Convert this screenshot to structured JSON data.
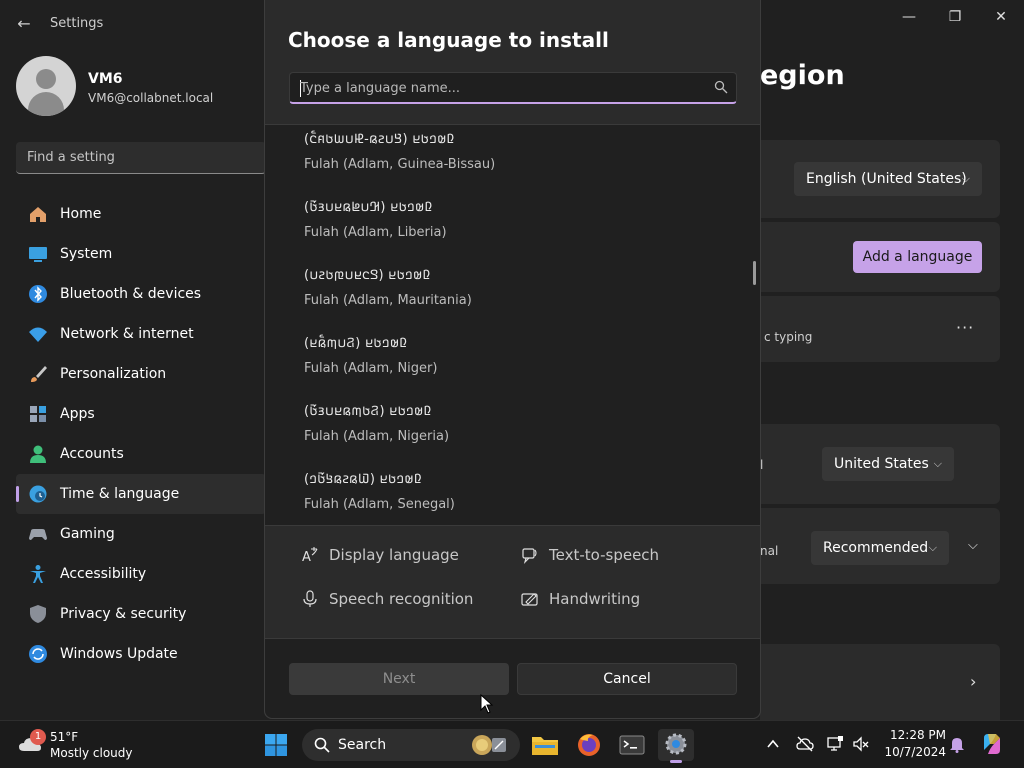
{
  "window": {
    "app_title": "Settings",
    "minimize_glyph": "—",
    "maximize_glyph": "❐",
    "close_glyph": "✕",
    "back_glyph": "←"
  },
  "profile": {
    "name": "VM6",
    "email": "VM6@collabnet.local"
  },
  "search": {
    "placeholder": "Find a setting"
  },
  "sidebar": {
    "items": [
      {
        "label": "Home",
        "icon": "home-icon",
        "color": "#e3a06a"
      },
      {
        "label": "System",
        "icon": "system-icon",
        "color": "#3aa0e0"
      },
      {
        "label": "Bluetooth & devices",
        "icon": "bluetooth-icon",
        "color": "#2f8ae0"
      },
      {
        "label": "Network & internet",
        "icon": "wifi-icon",
        "color": "#3a9ee8"
      },
      {
        "label": "Personalization",
        "icon": "brush-icon",
        "color": "#e89a5a"
      },
      {
        "label": "Apps",
        "icon": "apps-icon",
        "color": "#7a8ea8"
      },
      {
        "label": "Accounts",
        "icon": "person-icon",
        "color": "#3fbf7a"
      },
      {
        "label": "Time & language",
        "icon": "clock-globe-icon",
        "color": "#3aa0e0"
      },
      {
        "label": "Gaming",
        "icon": "gamepad-icon",
        "color": "#9aa0aa"
      },
      {
        "label": "Accessibility",
        "icon": "accessibility-icon",
        "color": "#3aa0e0"
      },
      {
        "label": "Privacy & security",
        "icon": "shield-icon",
        "color": "#8a8f98"
      },
      {
        "label": "Windows Update",
        "icon": "update-icon",
        "color": "#2f8ae0"
      }
    ],
    "selected_index": 7
  },
  "content": {
    "title_fragment": "egion",
    "display_language_value": "English (United States)",
    "add_language_label": "Add a language",
    "typing_fragment": "c typing",
    "more_glyph": "···",
    "country_value": "United States",
    "regional_fragment": "nal",
    "regional_format_value": "Recommended",
    "accent_color": "#c6a2e8"
  },
  "dialog": {
    "title": "Choose a language to install",
    "search_placeholder": "Type a language name...",
    "languages": [
      {
        "native": "(𞤘𞤭𞤲𞤫-𞤄𞤭𞤧𞤢𞤱𞤮𞥅) 𞤆𞤵𞤤𞤢𞤪",
        "name": "Fulah (Adlam, Guinea-Bissau)"
      },
      {
        "native": "(𞤂𞤭𞤦𞤫𞤪𞤭𞤴𞤢𞥄) 𞤆𞤵𞤤𞤢𞤪",
        "name": "Fulah (Adlam, Liberia)"
      },
      {
        "native": "(𞤃𞤮𞤪𞤭𞤼𞤢𞤲𞤭) 𞤆𞤵𞤤𞤢𞤪",
        "name": "Fulah (Adlam, Mauritania)"
      },
      {
        "native": "(𞤐𞤭𞤶𞤫𞥅𞤪) 𞤆𞤵𞤤𞤢𞤪",
        "name": "Fulah (Adlam, Niger)"
      },
      {
        "native": "(𞤐𞤢𞤶𞤫𞤪𞤭𞤴𞤢𞥄) 𞤆𞤵𞤤𞤢𞤪",
        "name": "Fulah (Adlam, Nigeria)"
      },
      {
        "native": "(𞤅𞤫𞤲𞤫𞤺𞤢𞥄𞤤) 𞤆𞤵𞤤𞤢𞤪",
        "name": "Fulah (Adlam, Senegal)"
      }
    ],
    "features": {
      "display_language": "Display language",
      "text_to_speech": "Text-to-speech",
      "speech_recognition": "Speech recognition",
      "handwriting": "Handwriting"
    },
    "next_label": "Next",
    "cancel_label": "Cancel"
  },
  "taskbar": {
    "weather_badge": "1",
    "temperature": "51°F",
    "condition": "Mostly cloudy",
    "search_label": "Search",
    "time": "12:28 PM",
    "date": "10/7/2024"
  }
}
